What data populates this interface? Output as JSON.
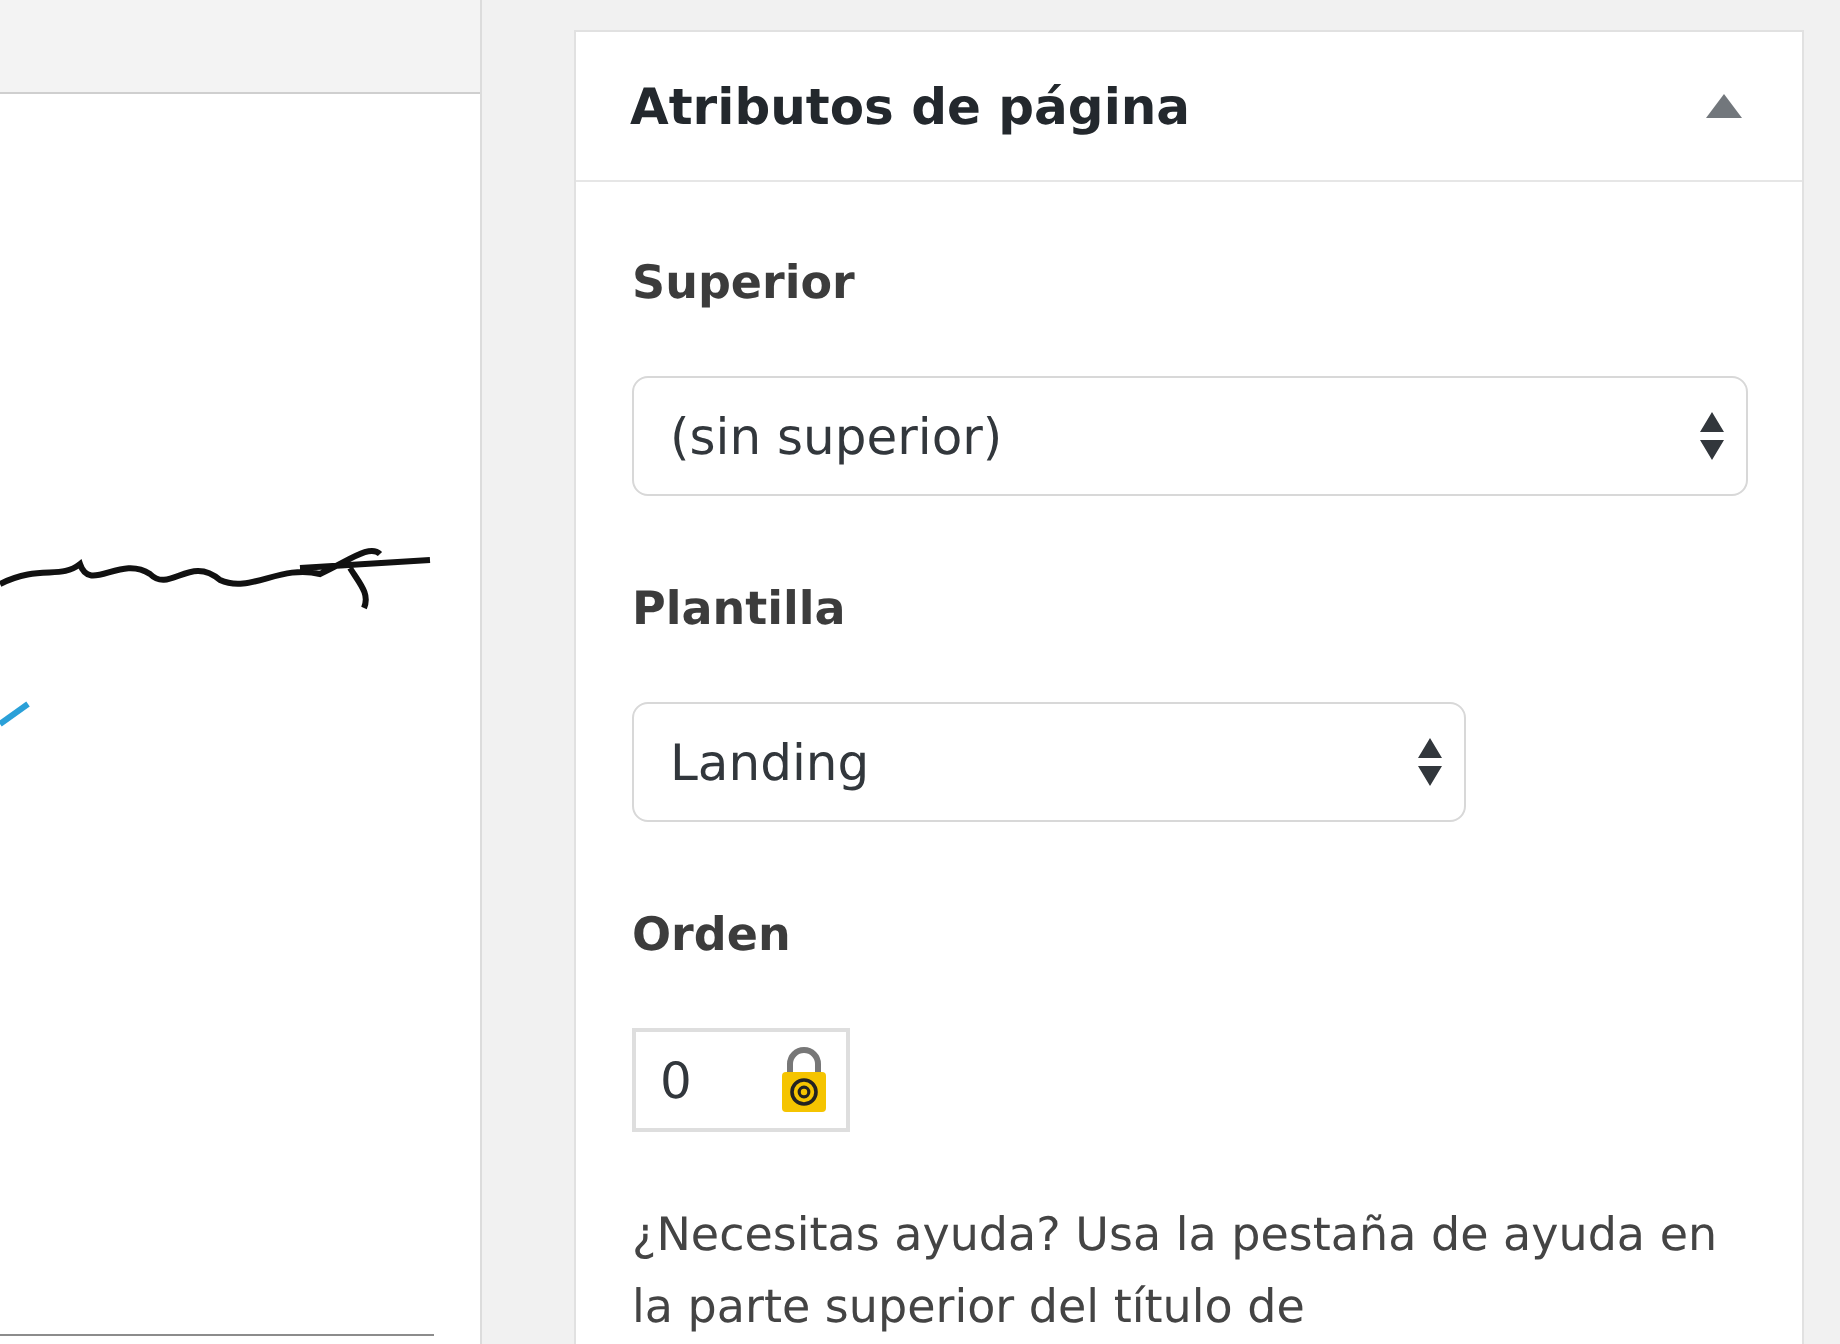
{
  "metabox": {
    "title": "Atributos de página",
    "expanded": true,
    "fields": [
      {
        "kind": "select",
        "label": "Superior",
        "value": "(sin superior)"
      },
      {
        "kind": "select",
        "label": "Plantilla",
        "value": "Landing"
      },
      {
        "kind": "number",
        "label": "Orden",
        "value": "0"
      }
    ],
    "help": "¿Necesitas ayuda? Usa la pestaña de ayuda en la parte superior del título de"
  }
}
